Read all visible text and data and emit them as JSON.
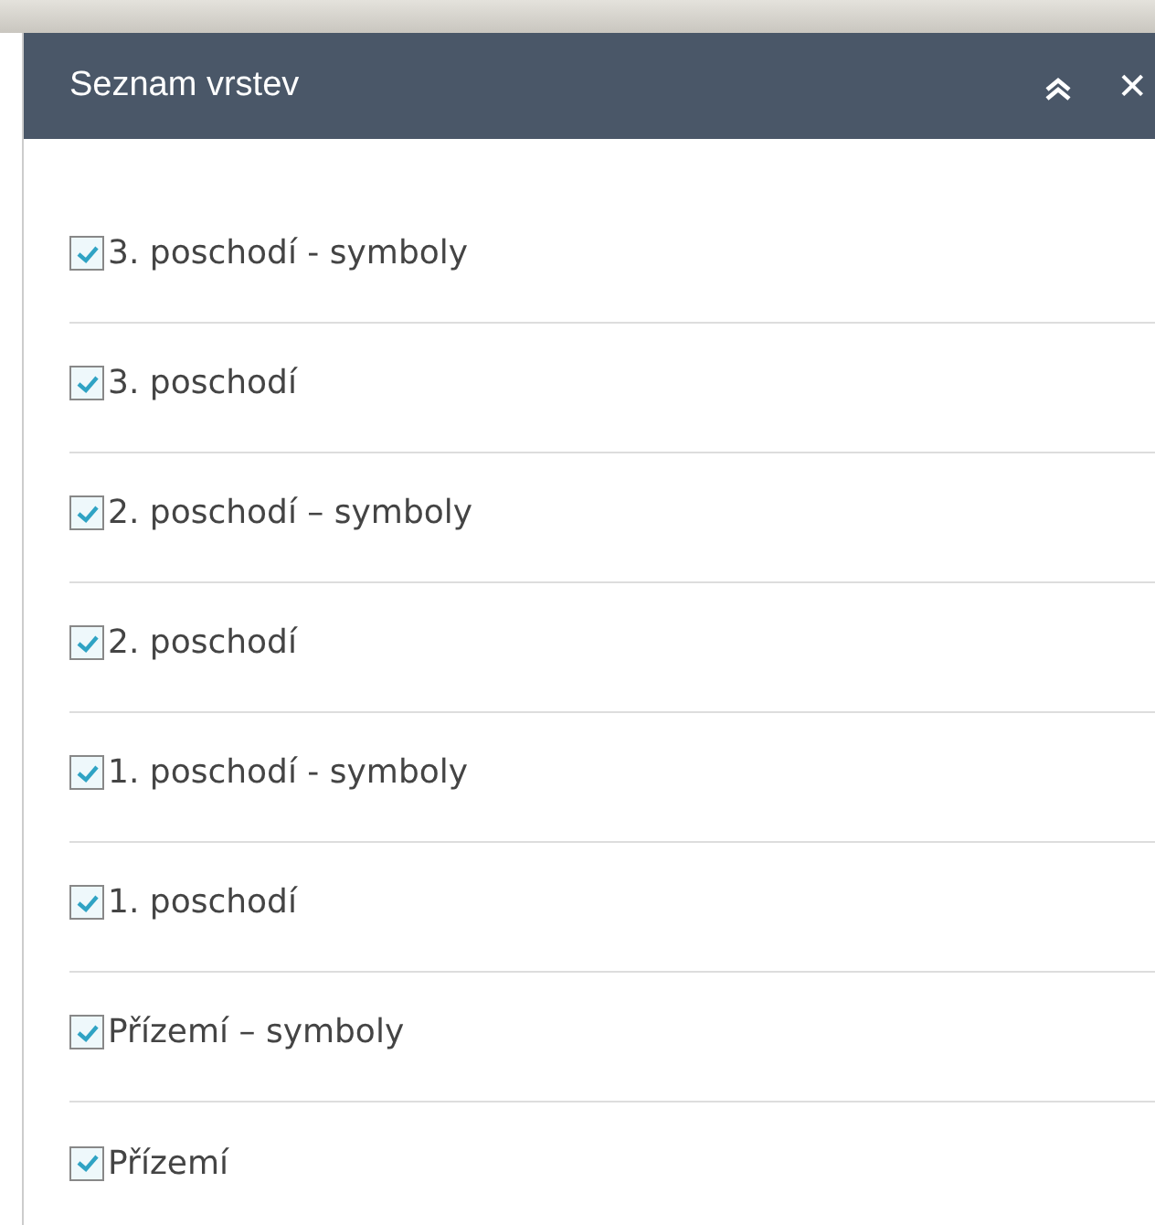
{
  "panel": {
    "title": "Seznam vrstev",
    "collapsed": false,
    "close_icon": "✕"
  },
  "layers": [
    {
      "label": "3. poschodí - symboly",
      "checked": true
    },
    {
      "label": "3. poschodí",
      "checked": true
    },
    {
      "label": "2. poschodí – symboly",
      "checked": true
    },
    {
      "label": "2. poschodí",
      "checked": true
    },
    {
      "label": "1. poschodí - symboly",
      "checked": true
    },
    {
      "label": "1. poschodí",
      "checked": true
    },
    {
      "label": "Přízemí – symboly",
      "checked": true
    },
    {
      "label": "Přízemí",
      "checked": true
    }
  ]
}
